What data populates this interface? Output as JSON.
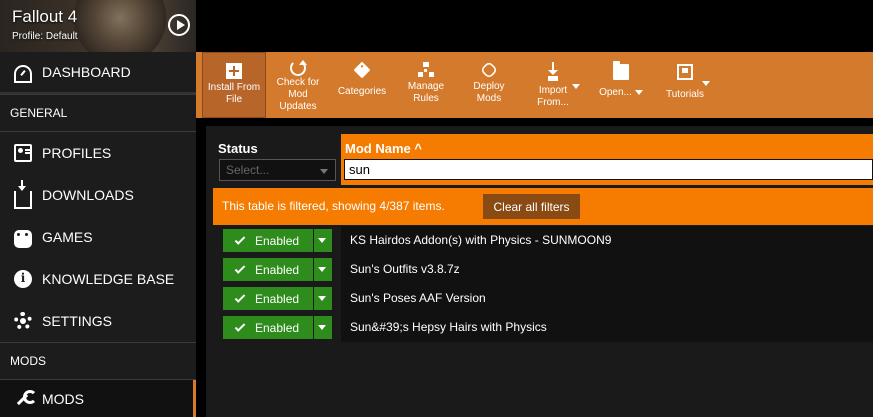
{
  "game": {
    "title": "Fallout 4",
    "profile": "Profile: Default"
  },
  "sidebar": {
    "dashboard": "DASHBOARD",
    "general_label": "GENERAL",
    "general_items": [
      {
        "label": "PROFILES",
        "icon": "profiles-icon"
      },
      {
        "label": "DOWNLOADS",
        "icon": "download-icon"
      },
      {
        "label": "GAMES",
        "icon": "gamepad-icon"
      },
      {
        "label": "KNOWLEDGE BASE",
        "icon": "info-icon"
      },
      {
        "label": "SETTINGS",
        "icon": "gear-icon"
      }
    ],
    "mods_label": "MODS",
    "mods_item": "MODS"
  },
  "toolbar": {
    "install_from_file": "Install From File",
    "check_for_updates": "Check for Mod Updates",
    "categories": "Categories",
    "manage_rules": "Manage Rules",
    "deploy_mods": "Deploy Mods",
    "import_from": "Import From...",
    "open": "Open...",
    "tutorials": "Tutorials"
  },
  "table": {
    "status_header": "Status",
    "status_placeholder": "Select...",
    "mod_name_header": "Mod Name ^",
    "search_value": "sun",
    "filter_message": "This table is filtered, showing 4/387 items.",
    "clear_filters": "Clear all filters",
    "rows": [
      {
        "status": "Enabled",
        "name": "KS Hairdos Addon(s) with Physics - SUNMOON9"
      },
      {
        "status": "Enabled",
        "name": "Sun's Outfits v3.8.7z"
      },
      {
        "status": "Enabled",
        "name": "Sun's Poses AAF Version"
      },
      {
        "status": "Enabled",
        "name": "Sun&#39;s Hepsy Hairs with Physics"
      }
    ]
  },
  "colors": {
    "accent": "#f57c00",
    "toolbar": "#d47a2c",
    "enabled": "#2d8c1c"
  }
}
